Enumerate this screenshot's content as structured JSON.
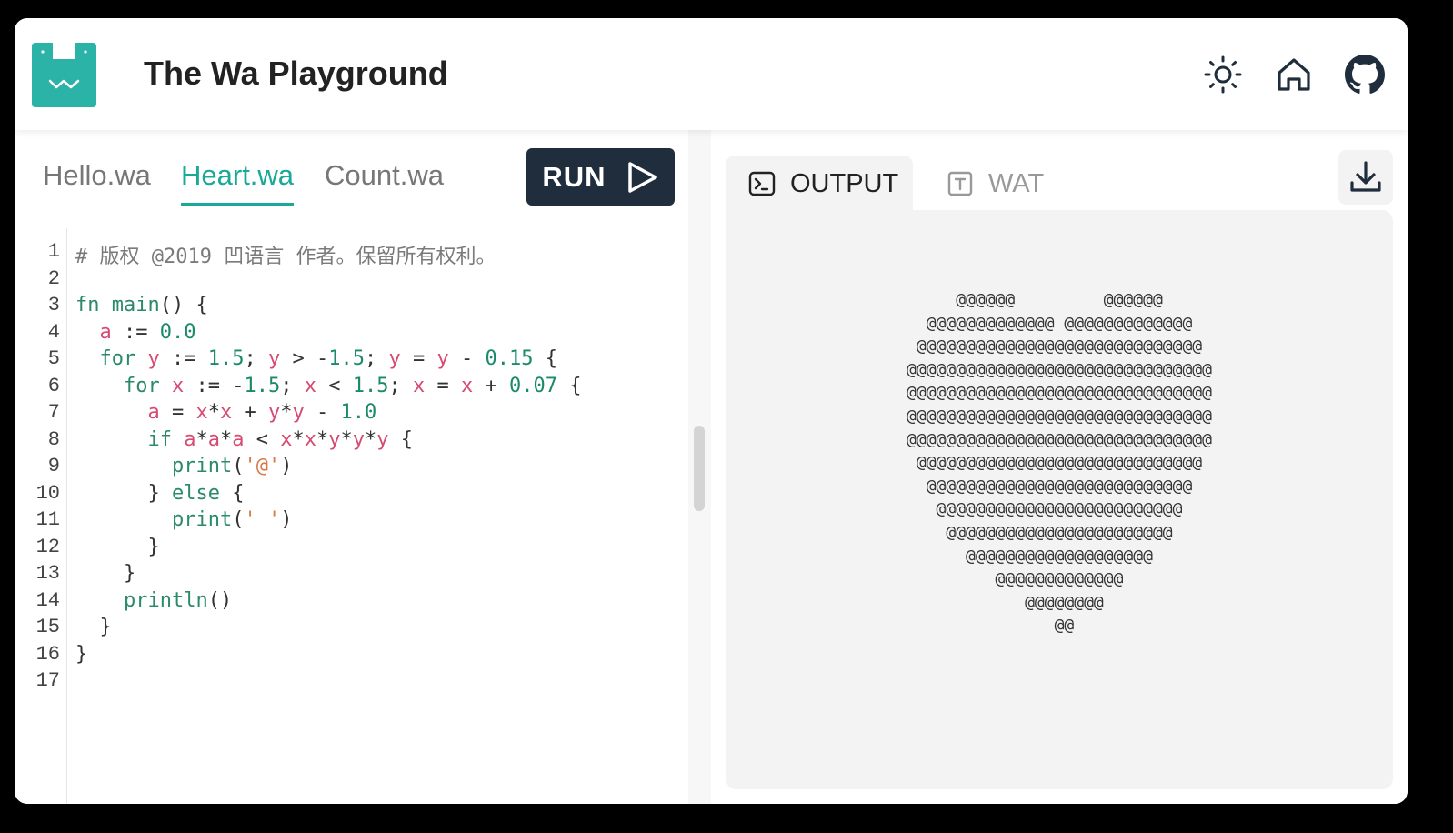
{
  "header": {
    "title": "The Wa Playground",
    "brand_color": "#2bb3a7",
    "icons": [
      "sun-icon",
      "home-icon",
      "github-icon"
    ]
  },
  "editor": {
    "tabs": [
      {
        "label": "Hello.wa",
        "active": false
      },
      {
        "label": "Heart.wa",
        "active": true
      },
      {
        "label": "Count.wa",
        "active": false
      }
    ],
    "run_label": "RUN",
    "line_numbers": [
      "1",
      "2",
      "3",
      "4",
      "5",
      "6",
      "7",
      "8",
      "9",
      "10",
      "11",
      "12",
      "13",
      "14",
      "15",
      "16",
      "17"
    ],
    "code_lines": [
      "# 版权 @2019 凹语言 作者。保留所有权利。",
      "",
      "fn main() {",
      "  a := 0.0",
      "  for y := 1.5; y > -1.5; y = y - 0.15 {",
      "    for x := -1.5; x < 1.5; x = x + 0.07 {",
      "      a = x*x + y*y - 1.0",
      "      if a*a*a < x*x*y*y*y {",
      "        print('@')",
      "      } else {",
      "        print(' ')",
      "      }",
      "    }",
      "    println()",
      "  }",
      "}",
      ""
    ]
  },
  "output": {
    "tabs": [
      {
        "label": "OUTPUT",
        "icon": "terminal-icon",
        "active": true
      },
      {
        "label": "WAT",
        "icon": "text-file-icon",
        "active": false
      }
    ],
    "download_icon": "download-icon",
    "lines": [
      "      @@@@@@         @@@@@@      ",
      "   @@@@@@@@@@@@@ @@@@@@@@@@@@@   ",
      "  @@@@@@@@@@@@@@@@@@@@@@@@@@@@@  ",
      " @@@@@@@@@@@@@@@@@@@@@@@@@@@@@@@ ",
      " @@@@@@@@@@@@@@@@@@@@@@@@@@@@@@@ ",
      " @@@@@@@@@@@@@@@@@@@@@@@@@@@@@@@ ",
      " @@@@@@@@@@@@@@@@@@@@@@@@@@@@@@@ ",
      "  @@@@@@@@@@@@@@@@@@@@@@@@@@@@@  ",
      "   @@@@@@@@@@@@@@@@@@@@@@@@@@@   ",
      "    @@@@@@@@@@@@@@@@@@@@@@@@@    ",
      "     @@@@@@@@@@@@@@@@@@@@@@@     ",
      "       @@@@@@@@@@@@@@@@@@@       ",
      "          @@@@@@@@@@@@@          ",
      "             @@@@@@@@            ",
      "                @@               "
    ]
  }
}
